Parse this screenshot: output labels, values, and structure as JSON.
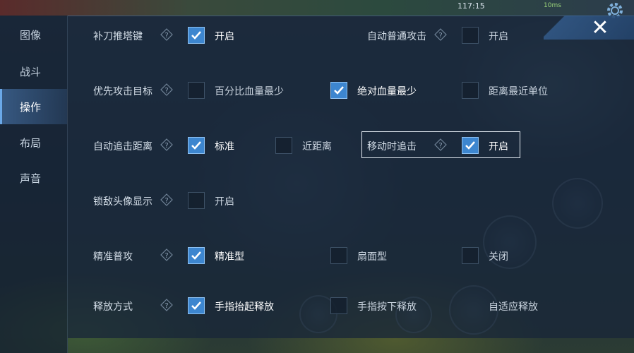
{
  "status": {
    "time": "117:15",
    "network": "10ms"
  },
  "sidebar": {
    "items": [
      {
        "label": "图像"
      },
      {
        "label": "战斗"
      },
      {
        "label": "操作"
      },
      {
        "label": "布局"
      },
      {
        "label": "声音"
      }
    ],
    "active_index": 2
  },
  "settings": {
    "last_hit_tower": {
      "label": "补刀推塔键",
      "options": [
        {
          "label": "开启",
          "checked": true
        }
      ]
    },
    "auto_attack": {
      "label": "自动普通攻击",
      "options": [
        {
          "label": "开启",
          "checked": false
        }
      ]
    },
    "priority_target": {
      "label": "优先攻击目标",
      "options": [
        {
          "label": "百分比血量最少",
          "checked": false
        },
        {
          "label": "绝对血量最少",
          "checked": true
        },
        {
          "label": "距离最近单位",
          "checked": false
        }
      ]
    },
    "auto_chase_distance": {
      "label": "自动追击距离",
      "options": [
        {
          "label": "标准",
          "checked": true
        },
        {
          "label": "近距离",
          "checked": false
        }
      ]
    },
    "chase_while_moving": {
      "label": "移动时追击",
      "options": [
        {
          "label": "开启",
          "checked": true
        }
      ]
    },
    "lock_enemy_avatar": {
      "label": "锁敌头像显示",
      "options": [
        {
          "label": "开启",
          "checked": false
        }
      ]
    },
    "precise_attack": {
      "label": "精准普攻",
      "options": [
        {
          "label": "精准型",
          "checked": true
        },
        {
          "label": "扇面型",
          "checked": false
        },
        {
          "label": "关闭",
          "checked": false
        }
      ]
    },
    "release_mode": {
      "label": "释放方式",
      "options": [
        {
          "label": "手指抬起释放",
          "checked": true
        },
        {
          "label": "手指按下释放",
          "checked": false
        },
        {
          "label": "自适应释放",
          "checked": false
        }
      ]
    }
  },
  "colors": {
    "accent": "#3d86cf",
    "panel": "#182638",
    "text": "#d5dfe9"
  },
  "icons": {
    "close": "close-icon",
    "help": "help-icon",
    "gear": "gear-icon"
  }
}
